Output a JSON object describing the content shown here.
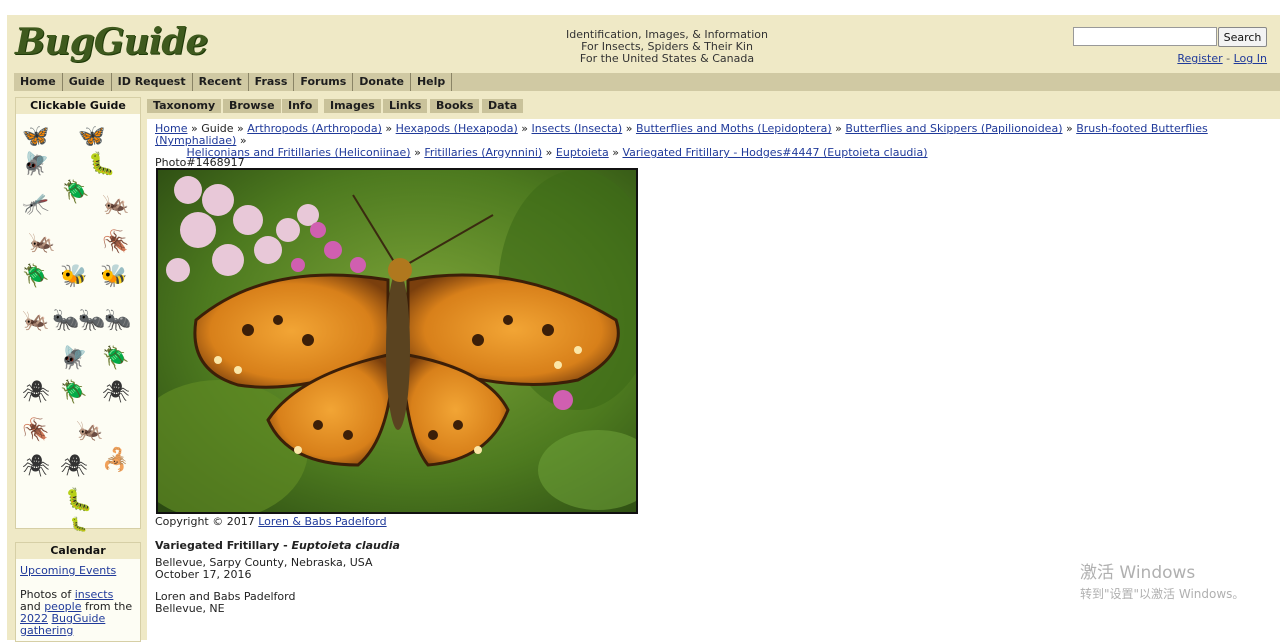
{
  "site": {
    "logo": "BugGuide",
    "tagline": [
      "Identification, Images, & Information",
      "For Insects, Spiders & Their Kin",
      "For the United States & Canada"
    ]
  },
  "search": {
    "value": "",
    "button": "Search"
  },
  "auth": {
    "register": "Register",
    "separator": "-",
    "login": "Log In"
  },
  "nav": [
    "Home",
    "Guide",
    "ID Request",
    "Recent",
    "Frass",
    "Forums",
    "Donate",
    "Help"
  ],
  "sidebar": {
    "guide_title": "Clickable Guide",
    "calendar_title": "Calendar",
    "upcoming_events": "Upcoming Events",
    "photos_text": [
      "Photos of",
      "insects",
      "and",
      "people",
      "from the",
      "2022",
      "BugGuide gathering"
    ]
  },
  "tabs": [
    "Taxonomy",
    "Browse",
    "Info",
    "Images",
    "Links",
    "Books",
    "Data"
  ],
  "breadcrumb": [
    {
      "label": "Home",
      "link": true
    },
    {
      "label": "Guide",
      "link": false
    },
    {
      "label": "Arthropods (Arthropoda)",
      "link": true
    },
    {
      "label": "Hexapods (Hexapoda)",
      "link": true
    },
    {
      "label": "Insects (Insecta)",
      "link": true
    },
    {
      "label": "Butterflies and Moths (Lepidoptera)",
      "link": true
    },
    {
      "label": "Butterflies and Skippers (Papilionoidea)",
      "link": true
    },
    {
      "label": "Brush-footed Butterflies (Nymphalidae)",
      "link": true
    },
    {
      "label": "Heliconians and Fritillaries (Heliconiinae)",
      "link": true
    },
    {
      "label": "Fritillaries (Argynnini)",
      "link": true
    },
    {
      "label": "Euptoieta",
      "link": true
    },
    {
      "label": "Variegated Fritillary - Hodges#4447 (Euptoieta claudia)",
      "link": true
    }
  ],
  "photo": {
    "id": "Photo#1468917",
    "copyright_prefix": "Copyright © 2017",
    "copyright_owner": "Loren & Babs Padelford",
    "common_name": "Variegated Fritillary -",
    "scientific_name": "Euptoieta claudia",
    "location": "Bellevue, Sarpy County, Nebraska, USA",
    "date": "October 17, 2016",
    "photographer": "Loren and Babs Padelford",
    "photographer_location": "Bellevue, NE"
  },
  "watermark": {
    "line1": "激活 Windows",
    "line2": "转到\"设置\"以激活 Windows。"
  }
}
